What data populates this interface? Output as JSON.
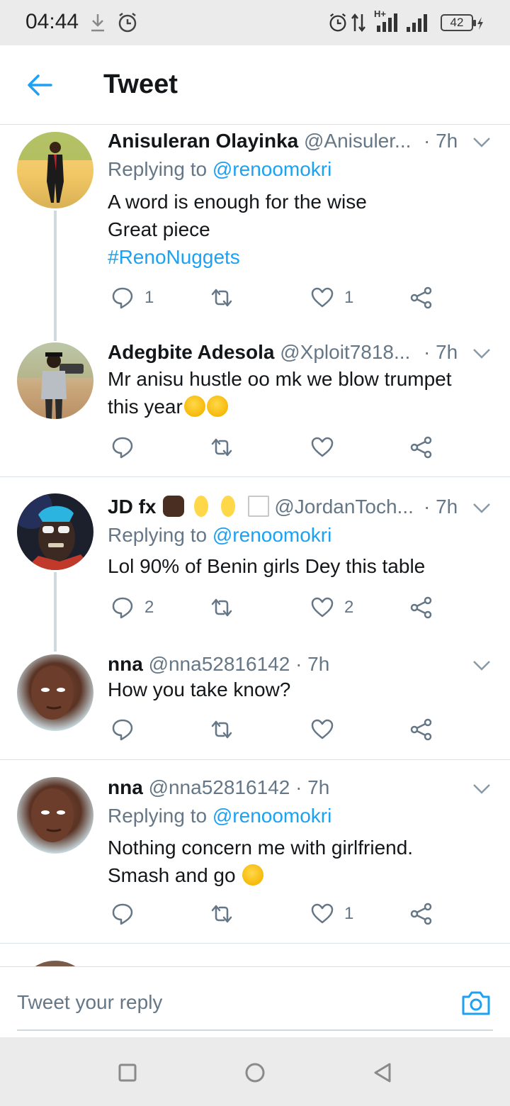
{
  "status_bar": {
    "time": "04:44",
    "network": "H+",
    "battery": "42",
    "icons": [
      "download-icon",
      "alarm-icon",
      "alarm-icon",
      "data-transfer-icon",
      "signal-icon",
      "signal-icon",
      "battery-icon",
      "charging-icon"
    ]
  },
  "header": {
    "title": "Tweet",
    "back_icon": "arrow-left-icon"
  },
  "tweets": [
    {
      "name": "Anisuleran Olayinka",
      "handle": "@Anisuler...",
      "time": "· 7h",
      "replying_prefix": "Replying to ",
      "replying_to": "@renoomokri",
      "text_lines": [
        "A word is enough for the wise",
        "Great piece"
      ],
      "hashtag": "#RenoNuggets",
      "reply_count": "1",
      "retweet_count": "",
      "like_count": "1"
    },
    {
      "name": "Adegbite Adesola",
      "handle": "@Xploit7818...",
      "time": "· 7h",
      "text_lines": [
        "Mr anisu hustle oo mk we blow trumpet",
        "this year"
      ],
      "reply_count": "",
      "retweet_count": "",
      "like_count": ""
    },
    {
      "name": "JD fx",
      "handle": "@JordanToch...",
      "time": "· 7h",
      "replying_prefix": "Replying to ",
      "replying_to": "@renoomokri",
      "text_lines": [
        "Lol 90% of Benin girls Dey this table"
      ],
      "reply_count": "2",
      "retweet_count": "",
      "like_count": "2"
    },
    {
      "name": "nna",
      "handle": "@nna52816142",
      "time": "· 7h",
      "text_lines": [
        "How you take know?"
      ],
      "reply_count": "",
      "retweet_count": "",
      "like_count": ""
    },
    {
      "name": "nna",
      "handle": "@nna52816142",
      "time": "· 7h",
      "replying_prefix": "Replying to ",
      "replying_to": "@renoomokri",
      "text_lines": [
        "Nothing concern me with girlfriend.",
        "Smash and go"
      ],
      "reply_count": "",
      "retweet_count": "",
      "like_count": "1"
    }
  ],
  "composer": {
    "placeholder": "Tweet your reply",
    "camera_icon": "camera-icon"
  },
  "nav_bar": {
    "icons": [
      "recents-square-icon",
      "home-circle-icon",
      "back-triangle-icon"
    ]
  },
  "colors": {
    "accent": "#1da1f2",
    "secondary_text": "#657786",
    "primary_text": "#14171a",
    "divider": "#dbe1e6"
  }
}
